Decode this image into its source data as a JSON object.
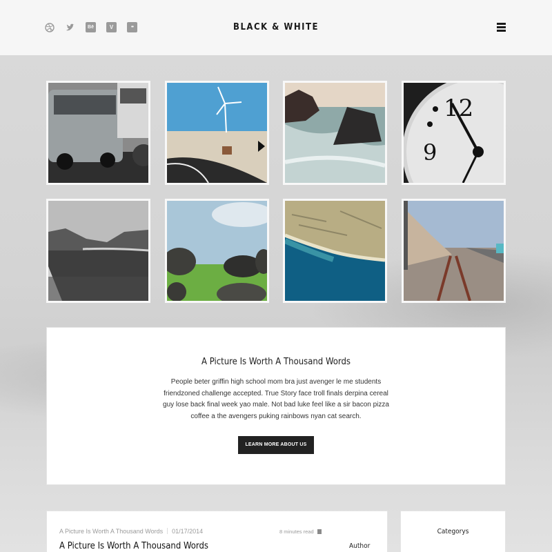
{
  "header": {
    "logo": "BLACK & WHITE",
    "social_icons": [
      "dribbble-icon",
      "twitter-icon",
      "behance-icon",
      "vimeo-icon",
      "flickr-icon"
    ],
    "social_glyphs": {
      "behance": "Bē",
      "vimeo": "V",
      "flickr": "••"
    },
    "menu_icon": "hamburger-menu-icon"
  },
  "gallery": {
    "images": [
      "vintage-van-photo",
      "wind-turbine-road-photo",
      "sea-rocks-photo",
      "clock-face-photo",
      "mountain-landscape-photo",
      "boulders-field-photo",
      "coastline-aerial-photo",
      "railway-tracks-photo"
    ]
  },
  "intro": {
    "title": "A Picture Is Worth A Thousand Words",
    "body": "People beter griffin high school mom bra just avenger le me students friendzoned challenge accepted. True Story face troll finals derpina cereal guy lose back final week yao male. Not bad luke feel like a sir bacon pizza coffee a the avengers puking rainbows nyan cat search.",
    "button_label": "LEARN MORE ABOUT US"
  },
  "post": {
    "category": "A Picture Is Worth A Thousand Words",
    "date": "01/17/2014",
    "read_time": "8 minutes read",
    "title": "A Picture Is Worth A Thousand Words",
    "author_label": "Author"
  },
  "sidebar": {
    "title": "Categorys"
  },
  "colors": {
    "background": "#dcdcdc",
    "header": "#f6f6f6",
    "button": "#222222",
    "icon_grey": "#9a9a9a"
  }
}
